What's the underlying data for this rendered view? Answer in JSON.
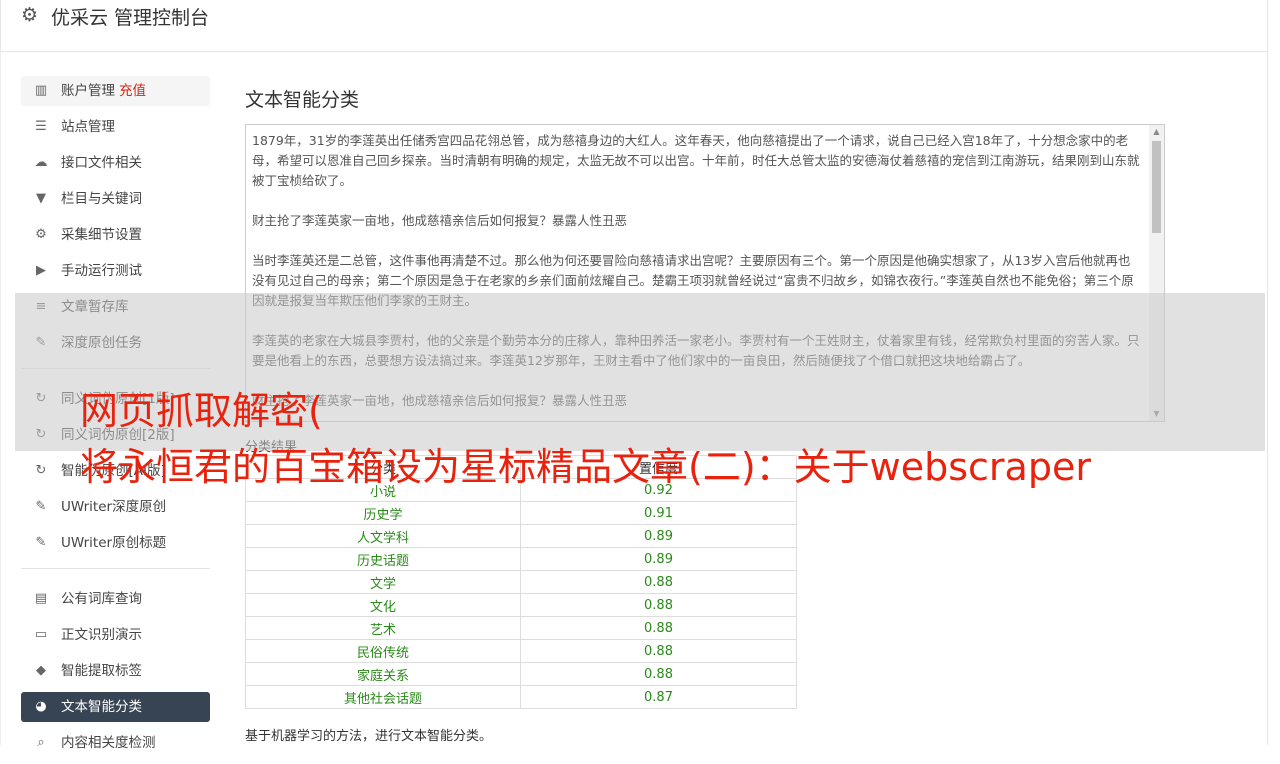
{
  "header": {
    "gear_icon": "gear-icon",
    "title": "优采云 管理控制台"
  },
  "sidebar": {
    "group1": [
      {
        "icon": "bar-chart-icon",
        "glyph": "▥",
        "label": "账户管理",
        "extra": "充值"
      },
      {
        "icon": "server-icon",
        "glyph": "☰",
        "label": "站点管理"
      },
      {
        "icon": "cloud-upload-icon",
        "glyph": "☁",
        "label": "接口文件相关"
      },
      {
        "icon": "filter-icon",
        "glyph": "▼",
        "label": "栏目与关键词"
      },
      {
        "icon": "cogs-icon",
        "glyph": "⚙",
        "label": "采集细节设置"
      },
      {
        "icon": "play-circle-icon",
        "glyph": "▶",
        "label": "手动运行测试"
      },
      {
        "icon": "database-icon",
        "glyph": "≡",
        "label": "文章暂存库"
      },
      {
        "icon": "edit-icon",
        "glyph": "✎",
        "label": "深度原创任务"
      }
    ],
    "group2": [
      {
        "icon": "refresh-icon",
        "glyph": "↻",
        "label": "同义词伪原创[1版]"
      },
      {
        "icon": "refresh-icon",
        "glyph": "↻",
        "label": "同义词伪原创[2版]"
      },
      {
        "icon": "refresh-icon",
        "glyph": "↻",
        "label": "智能伪原创[AI版]"
      },
      {
        "icon": "edit-icon",
        "glyph": "✎",
        "label": "UWriter深度原创"
      },
      {
        "icon": "edit-icon",
        "glyph": "✎",
        "label": "UWriter原创标题"
      }
    ],
    "group3": [
      {
        "icon": "book-icon",
        "glyph": "▤",
        "label": "公有词库查询"
      },
      {
        "icon": "monitor-icon",
        "glyph": "▭",
        "label": "正文识别演示"
      },
      {
        "icon": "tag-icon",
        "glyph": "◆",
        "label": "智能提取标签"
      },
      {
        "icon": "pie-chart-icon",
        "glyph": "◕",
        "label": "文本智能分类",
        "active": true
      },
      {
        "icon": "search-icon",
        "glyph": "⌕",
        "label": "内容相关度检测"
      }
    ]
  },
  "main": {
    "title": "文本智能分类",
    "text_paragraphs": [
      "1879年，31岁的李莲英出任储秀宫四品花翎总管，成为慈禧身边的大红人。这年春天，他向慈禧提出了一个请求，说自己已经入宫18年了，十分想念家中的老母，希望可以恩准自己回乡探亲。当时清朝有明确的规定，太监无故不可以出宫。十年前，时任大总管太监的安德海仗着慈禧的宠信到江南游玩，结果刚到山东就被丁宝桢给砍了。",
      "财主抢了李莲英家一亩地，他成慈禧亲信后如何报复？暴露人性丑恶",
      "当时李莲英还是二总管，这件事他再清楚不过。那么他为何还要冒险向慈禧请求出宫呢？主要原因有三个。第一个原因是他确实想家了，从13岁入宫后他就再也没有见过自己的母亲；第二个原因是急于在老家的乡亲们面前炫耀自己。楚霸王项羽就曾经说过“富贵不归故乡，如锦衣夜行。”李莲英自然也不能免俗；第三个原因就是报复当年欺压他们李家的王财主。",
      "李莲英的老家在大城县李贾村，他的父亲是个勤劳本分的庄稼人，靠种田养活一家老小。李贾村有一个王姓财主，仗着家里有钱，经常欺负村里面的穷苦人家。只要是他看上的东西，总要想方设法搞过来。李莲英12岁那年，王财主看中了他们家中的一亩良田，然后随便找了个借口就把这块地给霸占了。",
      "财主抢了李莲英家一亩地，他成慈禧亲信后如何报复？暴露人性丑恶"
    ],
    "result_label": "分类结果",
    "table": {
      "headers": [
        "分类",
        "置信度"
      ],
      "rows": [
        [
          "小说",
          "0.92"
        ],
        [
          "历史学",
          "0.91"
        ],
        [
          "人文学科",
          "0.89"
        ],
        [
          "历史话题",
          "0.89"
        ],
        [
          "文学",
          "0.88"
        ],
        [
          "文化",
          "0.88"
        ],
        [
          "艺术",
          "0.88"
        ],
        [
          "民俗传统",
          "0.88"
        ],
        [
          "家庭关系",
          "0.88"
        ],
        [
          "其他社会话题",
          "0.87"
        ]
      ]
    },
    "footnote": "基于机器学习的方法，进行文本智能分类。"
  },
  "watermark": {
    "line1": "网页抓取解密(",
    "line2": "将永恒君的百宝箱设为星标精品文章(二)：关于webscraper",
    "color": "#e8220c"
  }
}
